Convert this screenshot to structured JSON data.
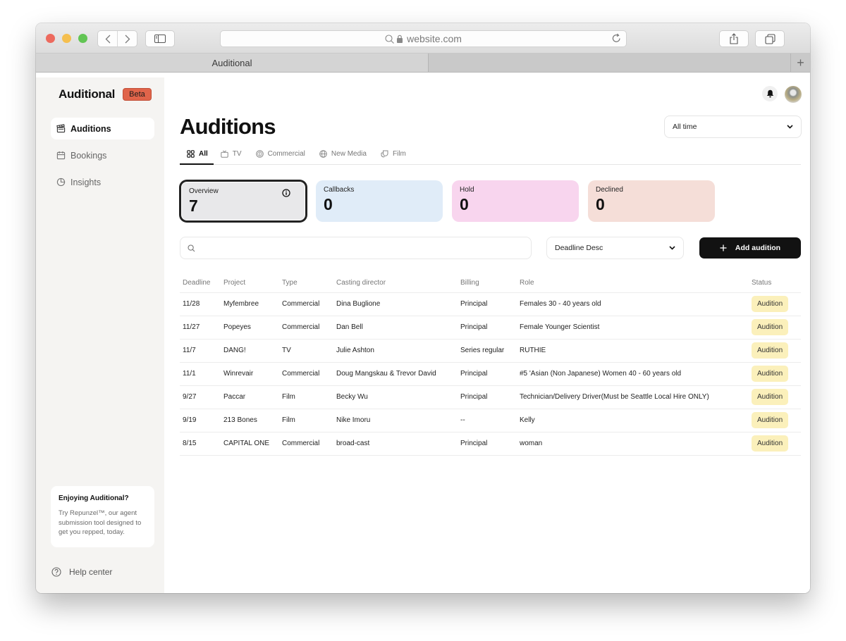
{
  "browser": {
    "url": "website.com",
    "tab_title": "Auditional",
    "new_tab_label": "+"
  },
  "app": {
    "brand": "Auditional",
    "beta_label": "Beta"
  },
  "sidebar": {
    "items": [
      {
        "label": "Auditions",
        "icon": "clapperboard-icon",
        "active": true
      },
      {
        "label": "Bookings",
        "icon": "calendar-icon",
        "active": false
      },
      {
        "label": "Insights",
        "icon": "pie-chart-icon",
        "active": false
      }
    ],
    "promo": {
      "title": "Enjoying Auditional?",
      "body": "Try Repunzel™, our agent submission tool designed to get you repped, today."
    },
    "help_label": "Help center"
  },
  "header": {
    "title": "Auditions",
    "period_select": "All time"
  },
  "type_tabs": [
    {
      "label": "All",
      "icon": "grid-icon",
      "active": true
    },
    {
      "label": "TV",
      "icon": "tv-icon",
      "active": false
    },
    {
      "label": "Commercial",
      "icon": "coin-icon",
      "active": false
    },
    {
      "label": "New Media",
      "icon": "globe-icon",
      "active": false
    },
    {
      "label": "Film",
      "icon": "masks-icon",
      "active": false
    }
  ],
  "stats": [
    {
      "label": "Overview",
      "value": "7"
    },
    {
      "label": "Callbacks",
      "value": "0"
    },
    {
      "label": "Hold",
      "value": "0"
    },
    {
      "label": "Declined",
      "value": "0"
    }
  ],
  "toolbar": {
    "search_placeholder": "",
    "search_value": "",
    "sort_select": "Deadline Desc",
    "add_label": "Add audition"
  },
  "table": {
    "columns": [
      "Deadline",
      "Project",
      "Type",
      "Casting director",
      "Billing",
      "Role",
      "Status"
    ],
    "rows": [
      [
        "11/28",
        "Myfembree",
        "Commercial",
        "Dina Buglione",
        "Principal",
        "Females 30 - 40 years old",
        "Audition"
      ],
      [
        "11/27",
        "Popeyes",
        "Commercial",
        "Dan Bell",
        "Principal",
        "Female Younger Scientist",
        "Audition"
      ],
      [
        "11/7",
        "DANG!",
        "TV",
        "Julie Ashton",
        "Series regular",
        "RUTHIE",
        "Audition"
      ],
      [
        "11/1",
        "Winrevair",
        "Commercial",
        "Doug Mangskau & Trevor David",
        "Principal",
        "#5 'Asian (Non Japanese) Women 40 - 60 years old",
        "Audition"
      ],
      [
        "9/27",
        "Paccar",
        "Film",
        "Becky Wu",
        "Principal",
        "Technician/Delivery Driver(Must be Seattle Local Hire ONLY)",
        "Audition"
      ],
      [
        "9/19",
        "213 Bones",
        "Film",
        "Nike Imoru",
        "--",
        "Kelly",
        "Audition"
      ],
      [
        "8/15",
        "CAPITAL ONE",
        "Commercial",
        "broad-cast",
        "Principal",
        "woman",
        "Audition"
      ]
    ]
  },
  "colors": {
    "beta": "#e0644a",
    "callbacks": "#e0ecf8",
    "hold": "#f8d5ee",
    "declined": "#f5ded8",
    "overview": "#e8e8ea",
    "status_badge": "#fbf0bb",
    "primary_button": "#121212"
  }
}
